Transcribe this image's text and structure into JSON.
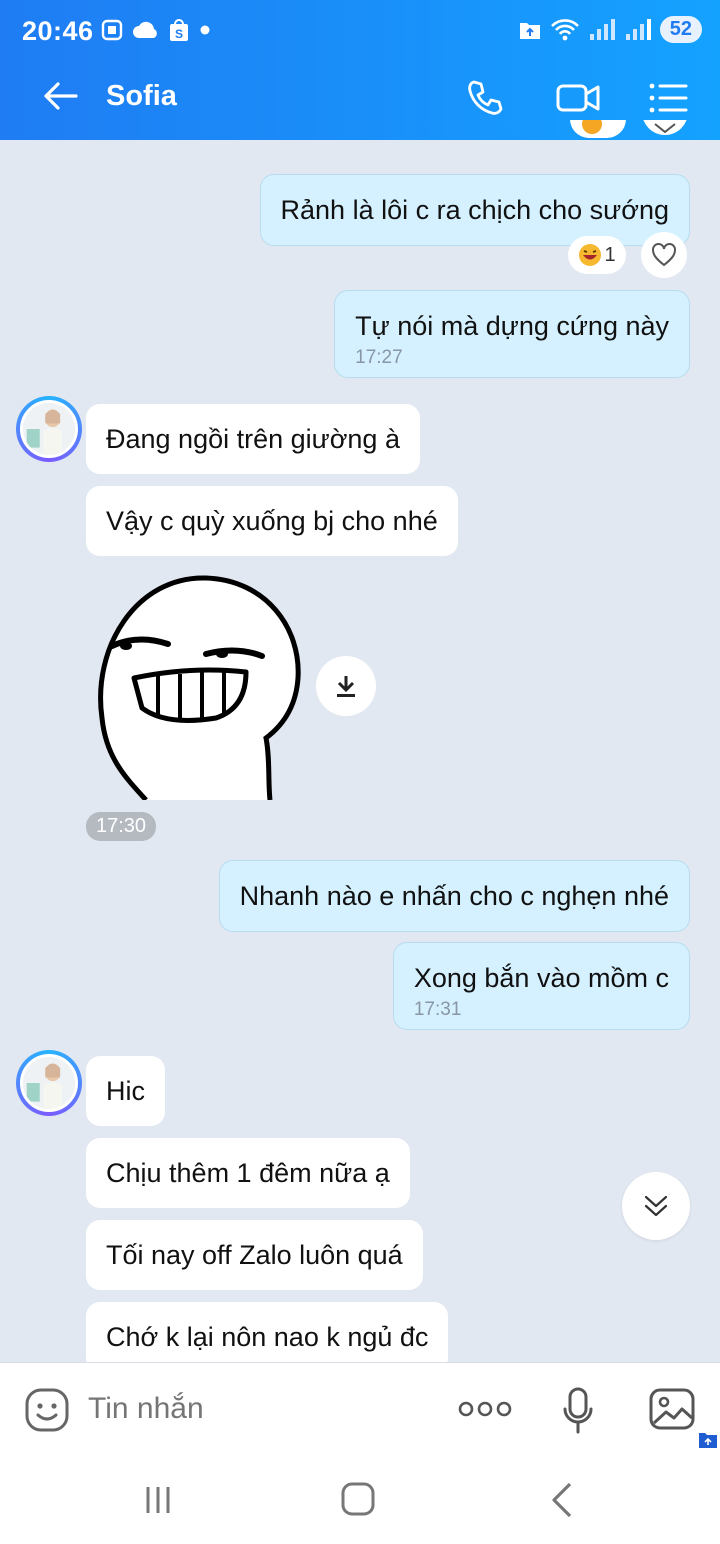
{
  "status_bar": {
    "time": "20:46",
    "battery": "52"
  },
  "header": {
    "title": "Sofia"
  },
  "messages": {
    "m1": {
      "text": "Rảnh là lôi c ra chịch cho sướng",
      "reaction_count": "1"
    },
    "m2": {
      "text": "Tự nói mà dựng cứng này",
      "time": "17:27"
    },
    "m3": {
      "text": "Đang ngồi trên giường à"
    },
    "m4": {
      "text": "Vậy c quỳ xuống bj cho nhé"
    },
    "sticker_time": "17:30",
    "m5": {
      "text": "Nhanh nào e nhấn cho c nghẹn nhé"
    },
    "m6": {
      "text": "Xong bắn vào mồm c",
      "time": "17:31"
    },
    "m7": {
      "text": "Hic"
    },
    "m8": {
      "text": "Chịu thêm 1 đêm nữa ạ"
    },
    "m9": {
      "text": "Tối nay off Zalo luôn quá"
    },
    "m10": {
      "text": "Chớ k lại nôn nao k ngủ đc"
    }
  },
  "composer": {
    "placeholder": "Tin nhắn"
  },
  "colors": {
    "header_start": "#1f7cf3",
    "header_end": "#14a2ff",
    "outgoing_bubble": "#d5f1ff",
    "incoming_bubble": "#ffffff",
    "chat_bg": "#e2e8f1"
  },
  "icons": [
    "back-arrow-icon",
    "phone-icon",
    "video-call-icon",
    "menu-list-icon",
    "download-icon",
    "scroll-down-icon",
    "emoji-icon",
    "more-icon",
    "microphone-icon",
    "image-icon"
  ]
}
